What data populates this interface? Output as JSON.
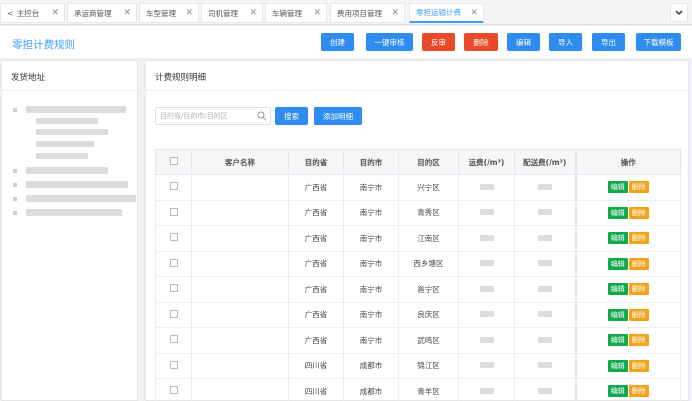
{
  "tabs": [
    {
      "label": "主控台",
      "closable": true
    },
    {
      "label": "承运商管理",
      "closable": true
    },
    {
      "label": "车型管理",
      "closable": true
    },
    {
      "label": "司机管理",
      "closable": true
    },
    {
      "label": "车辆管理",
      "closable": true
    },
    {
      "label": "费用项目管理",
      "closable": true
    },
    {
      "label": "零担运输计费",
      "closable": true,
      "active": true
    }
  ],
  "header": {
    "title": "零担计费规则",
    "buttons": {
      "create": "创建",
      "audit": "一键审核",
      "unaudit": "反审",
      "delete": "删除",
      "edit": "编辑",
      "import": "导入",
      "export": "导出",
      "download_template": "下载模板"
    }
  },
  "left_panel": {
    "title": "发货地址"
  },
  "right_panel": {
    "title": "计费规则明细",
    "search_placeholder": "目的省/目的市/目的区",
    "search_button": "搜索",
    "add_button": "添加明细"
  },
  "table": {
    "headers": {
      "customer": "客户名称",
      "province": "目的省",
      "city": "目的市",
      "district": "目的区",
      "freight": "运费(/m³)",
      "delivery": "配送费(/m³)",
      "ops": "操作"
    },
    "row_edit": "编辑",
    "row_delete": "删除",
    "rows": [
      {
        "customer": "",
        "province": "广西省",
        "city": "南宁市",
        "district": "兴宁区"
      },
      {
        "customer": "",
        "province": "广西省",
        "city": "南宁市",
        "district": "青秀区"
      },
      {
        "customer": "",
        "province": "广西省",
        "city": "南宁市",
        "district": "江南区"
      },
      {
        "customer": "",
        "province": "广西省",
        "city": "南宁市",
        "district": "西乡塘区"
      },
      {
        "customer": "",
        "province": "广西省",
        "city": "南宁市",
        "district": "邕宁区"
      },
      {
        "customer": "",
        "province": "广西省",
        "city": "南宁市",
        "district": "良庆区"
      },
      {
        "customer": "",
        "province": "广西省",
        "city": "南宁市",
        "district": "武鸣区"
      },
      {
        "customer": "",
        "province": "四川省",
        "city": "成都市",
        "district": "锦江区"
      },
      {
        "customer": "",
        "province": "四川省",
        "city": "成都市",
        "district": "青羊区"
      }
    ]
  },
  "colors": {
    "accent": "#409eff",
    "danger": "#e94b2a",
    "success": "#13a84b",
    "warning": "#f7a21b"
  }
}
